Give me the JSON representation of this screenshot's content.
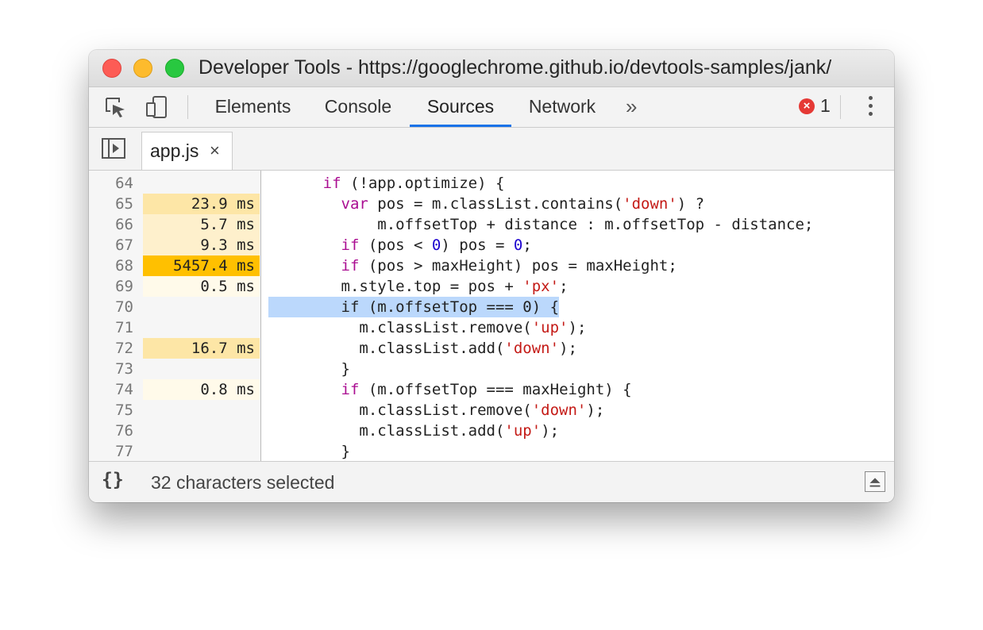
{
  "window": {
    "title": "Developer Tools - https://googlechrome.github.io/devtools-samples/jank/"
  },
  "toolbar": {
    "tabs": [
      {
        "label": "Elements",
        "active": false
      },
      {
        "label": "Console",
        "active": false
      },
      {
        "label": "Sources",
        "active": true
      },
      {
        "label": "Network",
        "active": false
      }
    ],
    "more_label": "»",
    "error_count": "1",
    "icons": [
      "inspect-element-icon",
      "device-toolbar-icon",
      "error-icon",
      "more-options-icon"
    ]
  },
  "filebar": {
    "file_name": "app.js",
    "close_label": "×"
  },
  "editor": {
    "lines": [
      {
        "num": "64",
        "time": "",
        "heat": "none"
      },
      {
        "num": "65",
        "time": "23.9 ms",
        "heat": "medium"
      },
      {
        "num": "66",
        "time": "5.7 ms",
        "heat": "light"
      },
      {
        "num": "67",
        "time": "9.3 ms",
        "heat": "light"
      },
      {
        "num": "68",
        "time": "5457.4 ms",
        "heat": "high"
      },
      {
        "num": "69",
        "time": "0.5 ms",
        "heat": "faint"
      },
      {
        "num": "70",
        "time": "",
        "heat": "none"
      },
      {
        "num": "71",
        "time": "",
        "heat": "none"
      },
      {
        "num": "72",
        "time": "16.7 ms",
        "heat": "medium"
      },
      {
        "num": "73",
        "time": "",
        "heat": "none"
      },
      {
        "num": "74",
        "time": "0.8 ms",
        "heat": "faint"
      },
      {
        "num": "75",
        "time": "",
        "heat": "none"
      },
      {
        "num": "76",
        "time": "",
        "heat": "none"
      },
      {
        "num": "77",
        "time": "",
        "heat": "none"
      }
    ],
    "code": [
      [
        {
          "t": "      "
        },
        {
          "t": "if",
          "c": "kw"
        },
        {
          "t": " (!app.optimize) {"
        }
      ],
      [
        {
          "t": "        "
        },
        {
          "t": "var",
          "c": "kw"
        },
        {
          "t": " pos = m.classList.contains("
        },
        {
          "t": "'down'",
          "c": "str"
        },
        {
          "t": ") ?"
        }
      ],
      [
        {
          "t": "            m.offsetTop + distance : m.offsetTop - distance;"
        }
      ],
      [
        {
          "t": "        "
        },
        {
          "t": "if",
          "c": "kw"
        },
        {
          "t": " (pos < "
        },
        {
          "t": "0",
          "c": "num"
        },
        {
          "t": ") pos = "
        },
        {
          "t": "0",
          "c": "num"
        },
        {
          "t": ";"
        }
      ],
      [
        {
          "t": "        "
        },
        {
          "t": "if",
          "c": "kw"
        },
        {
          "t": " (pos > maxHeight) pos = maxHeight;"
        }
      ],
      [
        {
          "t": "        m.style.top = pos + "
        },
        {
          "t": "'px'",
          "c": "str"
        },
        {
          "t": ";"
        }
      ],
      [
        {
          "t": "        if (m.offsetTop === 0) {"
        }
      ],
      [
        {
          "t": "          m.classList.remove("
        },
        {
          "t": "'up'",
          "c": "str"
        },
        {
          "t": ");"
        }
      ],
      [
        {
          "t": "          m.classList.add("
        },
        {
          "t": "'down'",
          "c": "str"
        },
        {
          "t": ");"
        }
      ],
      [
        {
          "t": "        }"
        }
      ],
      [
        {
          "t": "        "
        },
        {
          "t": "if",
          "c": "kw"
        },
        {
          "t": " (m.offsetTop === maxHeight) {"
        }
      ],
      [
        {
          "t": "          m.classList.remove("
        },
        {
          "t": "'down'",
          "c": "str"
        },
        {
          "t": ");"
        }
      ],
      [
        {
          "t": "          m.classList.add("
        },
        {
          "t": "'up'",
          "c": "str"
        },
        {
          "t": ");"
        }
      ],
      [
        {
          "t": "        }"
        }
      ]
    ],
    "selected_line_index": 6
  },
  "statusbar": {
    "format_label": "{}",
    "selection_text": "32 characters selected"
  },
  "colors": {
    "heat_high": "#ffc000",
    "heat_medium": "#fde6a6",
    "heat_light": "#fef0cc",
    "heat_faint": "#fffaea",
    "selection": "#bbd8fc",
    "active_tab_underline": "#1a73e8"
  }
}
